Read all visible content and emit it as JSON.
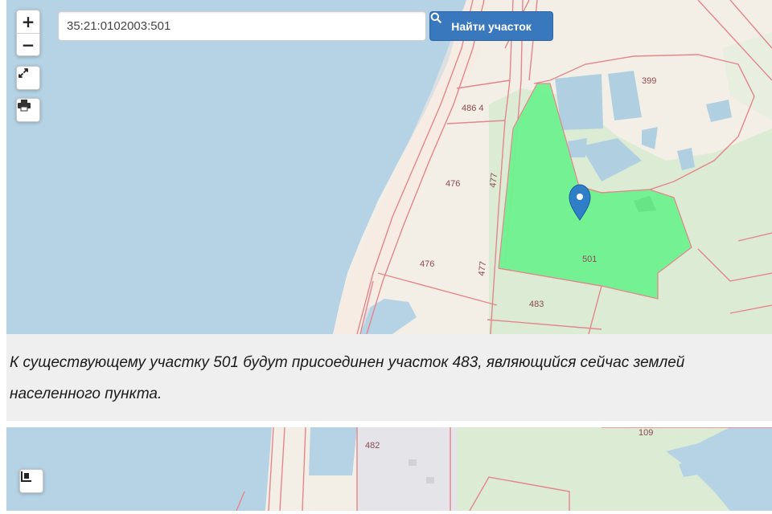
{
  "search": {
    "value": "35:21:0102003:501",
    "button_label": "Найти участок"
  },
  "controls": {
    "zoom_in": "+",
    "zoom_out": "−"
  },
  "parcels": {
    "p399": "399",
    "p486_4": "486 4",
    "p476a": "476",
    "p477a": "477",
    "p476b": "476",
    "p477b": "477",
    "p501": "501",
    "p483": "483",
    "p482": "482",
    "p109": "109"
  },
  "caption": {
    "text": "К существующему участку 501 будут присоединен участок 483, являющийся сейчас землей населенного пункта."
  },
  "colors": {
    "water": "#b5d3e4",
    "land": "#f4efe6",
    "forest": "#dcebd4",
    "selected_parcel": "#6ef28f",
    "parcel_border": "#e3868c",
    "marker": "#2f7fc8",
    "button": "#3a78bd"
  },
  "icons": {
    "fullscreen": "fullscreen-icon",
    "print": "print-icon",
    "search": "search-icon",
    "marker": "map-marker-icon",
    "layers": "layers-icon"
  }
}
